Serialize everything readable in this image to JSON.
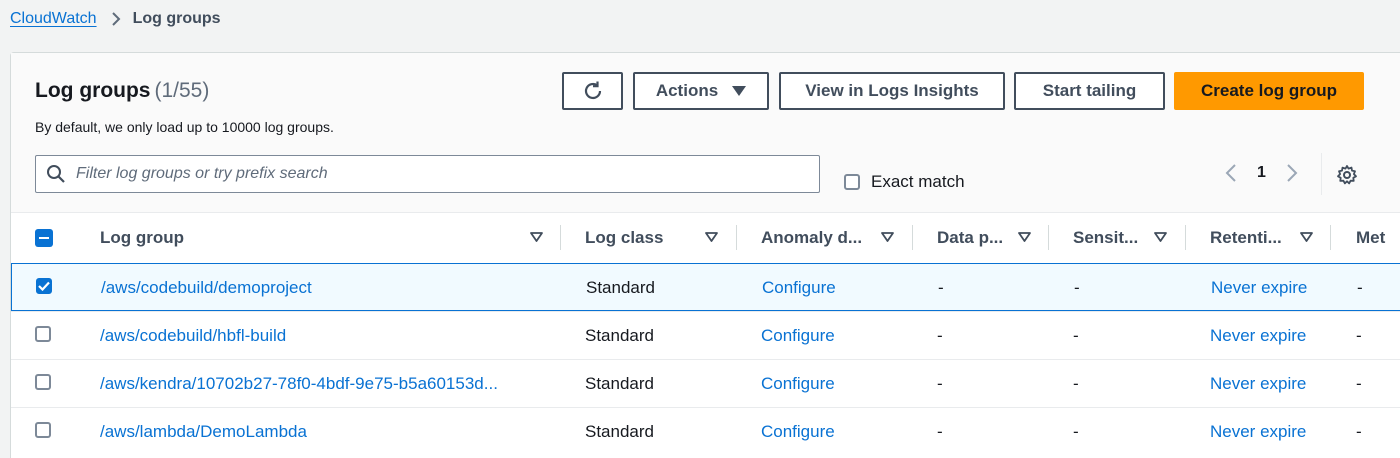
{
  "breadcrumb": {
    "root": "CloudWatch",
    "current": "Log groups"
  },
  "panel": {
    "title": "Log groups",
    "count": "(1/55)",
    "subtitle": "By default, we only load up to 10000 log groups."
  },
  "toolbar": {
    "actions_label": "Actions",
    "insights_label": "View in Logs Insights",
    "tailing_label": "Start tailing",
    "create_label": "Create log group"
  },
  "filter": {
    "placeholder": "Filter log groups or try prefix search",
    "value": ""
  },
  "exact_match": {
    "label": "Exact match",
    "checked": false
  },
  "pagination": {
    "current_page": "1"
  },
  "columns": [
    "Log group",
    "Log class",
    "Anomaly d...",
    "Data p...",
    "Sensit...",
    "Retenti...",
    "Met"
  ],
  "rows": [
    {
      "selected": true,
      "log_group": "/aws/codebuild/demoproject",
      "log_class": "Standard",
      "anomaly": "Configure",
      "data_protection": "-",
      "sensitive": "-",
      "retention": "Never expire",
      "metric": "-"
    },
    {
      "selected": false,
      "log_group": "/aws/codebuild/hbfl-build",
      "log_class": "Standard",
      "anomaly": "Configure",
      "data_protection": "-",
      "sensitive": "-",
      "retention": "Never expire",
      "metric": "-"
    },
    {
      "selected": false,
      "log_group": "/aws/kendra/10702b27-78f0-4bdf-9e75-b5a60153d...",
      "log_class": "Standard",
      "anomaly": "Configure",
      "data_protection": "-",
      "sensitive": "-",
      "retention": "Never expire",
      "metric": "-"
    },
    {
      "selected": false,
      "log_group": "/aws/lambda/DemoLambda",
      "log_class": "Standard",
      "anomaly": "Configure",
      "data_protection": "-",
      "sensitive": "-",
      "retention": "Never expire",
      "metric": "-"
    }
  ],
  "colors": {
    "link": "#0972d3",
    "primary_button": "#ff9900",
    "selected_row_bg": "#f1faff"
  },
  "icons": [
    "chevron-right-icon",
    "refresh-icon",
    "caret-down-icon",
    "search-icon",
    "chevron-left-icon",
    "settings-gear-icon",
    "sort-caret-icon",
    "checkmark-icon"
  ]
}
